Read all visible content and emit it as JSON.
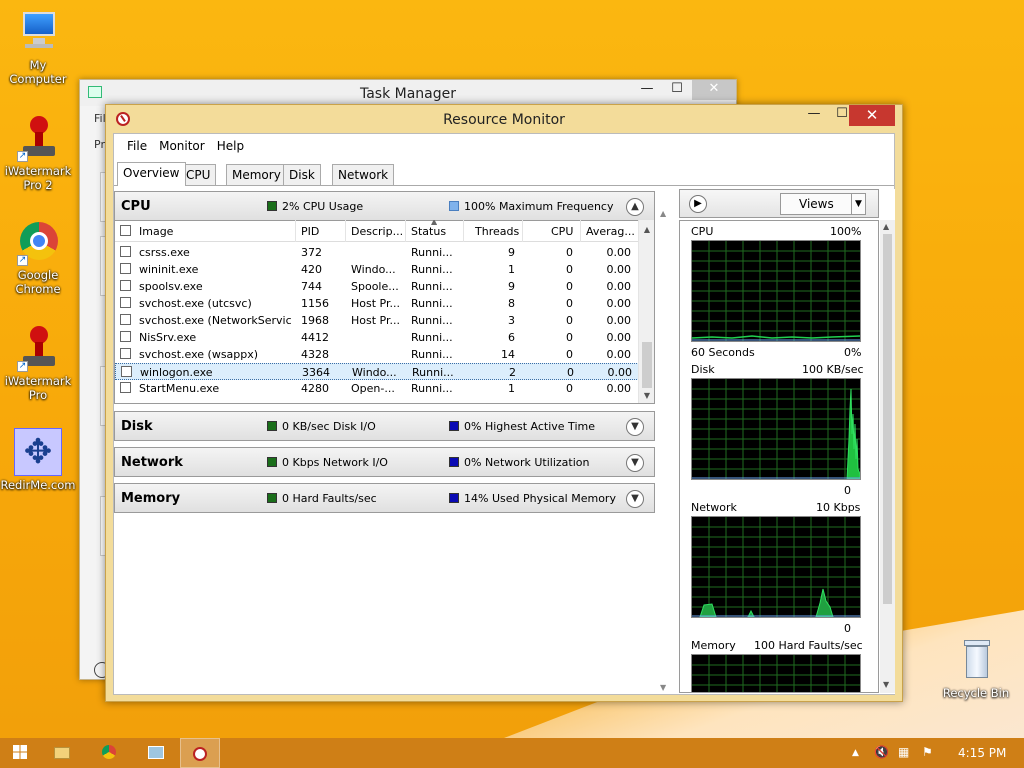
{
  "desktop": {
    "icons": [
      {
        "label": "My Computer"
      },
      {
        "label": "iWatermark Pro 2"
      },
      {
        "label": "Google Chrome"
      },
      {
        "label": "iWatermark Pro"
      },
      {
        "label": "RedirMe.com"
      },
      {
        "label": "Recycle Bin"
      }
    ]
  },
  "task_manager": {
    "title": "Task Manager",
    "side_labels": [
      "Fil",
      "Pr"
    ]
  },
  "resource_monitor": {
    "title": "Resource Monitor",
    "menu": [
      "File",
      "Monitor",
      "Help"
    ],
    "tabs": [
      "Overview",
      "CPU",
      "Memory",
      "Disk",
      "Network"
    ],
    "cpu_section": {
      "name": "CPU",
      "kpi1": "2% CPU Usage",
      "kpi1_color": "#1a6e1a",
      "kpi2": "100% Maximum Frequency",
      "kpi2_color": "#7fb2ec",
      "columns": [
        "Image",
        "PID",
        "Descrip...",
        "Status",
        "Threads",
        "CPU",
        "Averag..."
      ],
      "rows": [
        {
          "image": "csrss.exe",
          "pid": "372",
          "desc": "",
          "status": "Runni...",
          "threads": "9",
          "cpu": "0",
          "avg": "0.00"
        },
        {
          "image": "wininit.exe",
          "pid": "420",
          "desc": "Windo...",
          "status": "Runni...",
          "threads": "1",
          "cpu": "0",
          "avg": "0.00"
        },
        {
          "image": "spoolsv.exe",
          "pid": "744",
          "desc": "Spoole...",
          "status": "Runni...",
          "threads": "9",
          "cpu": "0",
          "avg": "0.00"
        },
        {
          "image": "svchost.exe (utcsvc)",
          "pid": "1156",
          "desc": "Host Pr...",
          "status": "Runni...",
          "threads": "8",
          "cpu": "0",
          "avg": "0.00"
        },
        {
          "image": "svchost.exe (NetworkService...",
          "pid": "1968",
          "desc": "Host Pr...",
          "status": "Runni...",
          "threads": "3",
          "cpu": "0",
          "avg": "0.00"
        },
        {
          "image": "NisSrv.exe",
          "pid": "4412",
          "desc": "",
          "status": "Runni...",
          "threads": "6",
          "cpu": "0",
          "avg": "0.00"
        },
        {
          "image": "svchost.exe (wsappx)",
          "pid": "4328",
          "desc": "",
          "status": "Runni...",
          "threads": "14",
          "cpu": "0",
          "avg": "0.00"
        },
        {
          "image": "winlogon.exe",
          "pid": "3364",
          "desc": "Windo...",
          "status": "Runni...",
          "threads": "2",
          "cpu": "0",
          "avg": "0.00"
        },
        {
          "image": "StartMenu.exe",
          "pid": "4280",
          "desc": "Open-...",
          "status": "Runni...",
          "threads": "1",
          "cpu": "0",
          "avg": "0.00"
        }
      ]
    },
    "disk_section": {
      "name": "Disk",
      "kpi1": "0 KB/sec Disk I/O",
      "kpi2": "0% Highest Active Time"
    },
    "network_section": {
      "name": "Network",
      "kpi1": "0 Kbps Network I/O",
      "kpi2": "0% Network Utilization"
    },
    "memory_section": {
      "name": "Memory",
      "kpi1": "0 Hard Faults/sec",
      "kpi2": "14% Used Physical Memory"
    },
    "kpi_colors": {
      "green": "#1a6e1a",
      "blue": "#0a0ab4"
    },
    "right_panel": {
      "views_label": "Views",
      "graphs": [
        {
          "name": "CPU",
          "max": "100%",
          "bottom_left": "60 Seconds",
          "bottom_right": "0%"
        },
        {
          "name": "Disk",
          "max": "100 KB/sec",
          "bottom_left": "",
          "bottom_right": "0"
        },
        {
          "name": "Network",
          "max": "10 Kbps",
          "bottom_left": "",
          "bottom_right": "0"
        },
        {
          "name": "Memory",
          "max": "100 Hard Faults/sec",
          "bottom_left": "",
          "bottom_right": ""
        }
      ]
    }
  },
  "taskbar": {
    "clock": "4:15 PM"
  }
}
